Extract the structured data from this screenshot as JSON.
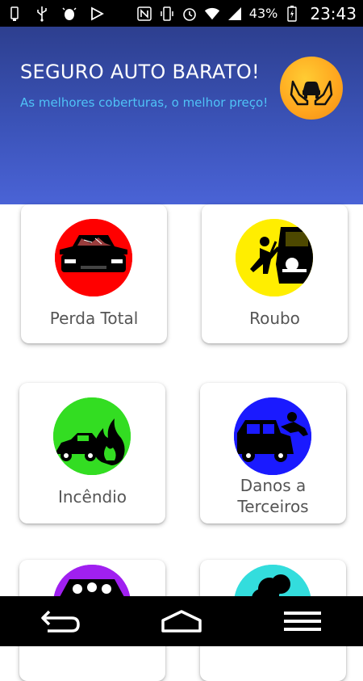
{
  "status_bar": {
    "battery_percent": "43%",
    "time": "23:43",
    "icons_left": [
      "usb-icon",
      "usb-debug-icon",
      "android-debug-icon",
      "play-store-icon"
    ],
    "icons_right": [
      "nfc-icon",
      "vibrate-icon",
      "alarm-icon",
      "wifi-icon",
      "signal-icon",
      "battery-charging-icon"
    ]
  },
  "header": {
    "title": "SEGURO AUTO BARATO!",
    "subtitle": "As melhores coberturas, o melhor preço!",
    "logo_icon": "hands-car-icon"
  },
  "grid": {
    "items": [
      {
        "label": "Perda Total",
        "icon": "wrecked-car-icon",
        "color": "#ff0000"
      },
      {
        "label": "Roubo",
        "icon": "car-theft-icon",
        "color": "#ffee00"
      },
      {
        "label": "Incêndio",
        "icon": "car-fire-icon",
        "color": "#33dd22"
      },
      {
        "label": "Danos a Terceiros",
        "label_line1": "Danos a",
        "label_line2": "Terceiros",
        "icon": "car-hits-person-icon",
        "color": "#1a1aff"
      },
      {
        "label": "",
        "icon": "car-passengers-icon",
        "color": "#a020f0"
      },
      {
        "label": "",
        "icon": "tree-icon",
        "color": "#33dddd"
      }
    ]
  },
  "nav": {
    "back": "back-icon",
    "home": "home-icon",
    "menu": "menu-icon"
  }
}
